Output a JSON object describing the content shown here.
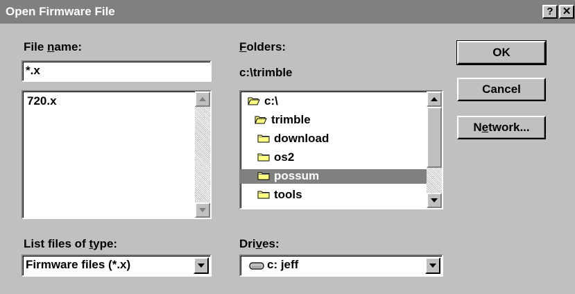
{
  "window": {
    "title": "Open Firmware File",
    "help_label": "?",
    "close_label": "✕"
  },
  "filename": {
    "label_pre": "File ",
    "label_u": "n",
    "label_post": "ame:",
    "value": "*.x",
    "files": [
      "720.x"
    ]
  },
  "folders": {
    "label_u": "F",
    "label_post": "olders:",
    "current_path": "c:\\trimble",
    "items": [
      {
        "name": "c:\\",
        "icon": "open-folder-icon",
        "selected": false
      },
      {
        "name": "trimble",
        "icon": "open-folder-icon",
        "selected": false
      },
      {
        "name": "download",
        "icon": "folder-icon",
        "selected": false
      },
      {
        "name": "os2",
        "icon": "folder-icon",
        "selected": false
      },
      {
        "name": "possum",
        "icon": "folder-icon",
        "selected": true
      },
      {
        "name": "tools",
        "icon": "folder-icon",
        "selected": false
      }
    ]
  },
  "filetype": {
    "label_pre": "List files of ",
    "label_u": "t",
    "label_post": "ype:",
    "value": "Firmware files (*.x)"
  },
  "drives": {
    "label_pre": "Dri",
    "label_u": "v",
    "label_post": "es:",
    "value": "c: jeff",
    "icon": "drive-icon"
  },
  "buttons": {
    "ok": "OK",
    "cancel": "Cancel",
    "network_pre": "N",
    "network_u": "e",
    "network_post": "twork..."
  },
  "colors": {
    "title_bar": "#808080",
    "face": "#c0c0c0",
    "selection": "#808080",
    "folder": "#ffff80"
  }
}
